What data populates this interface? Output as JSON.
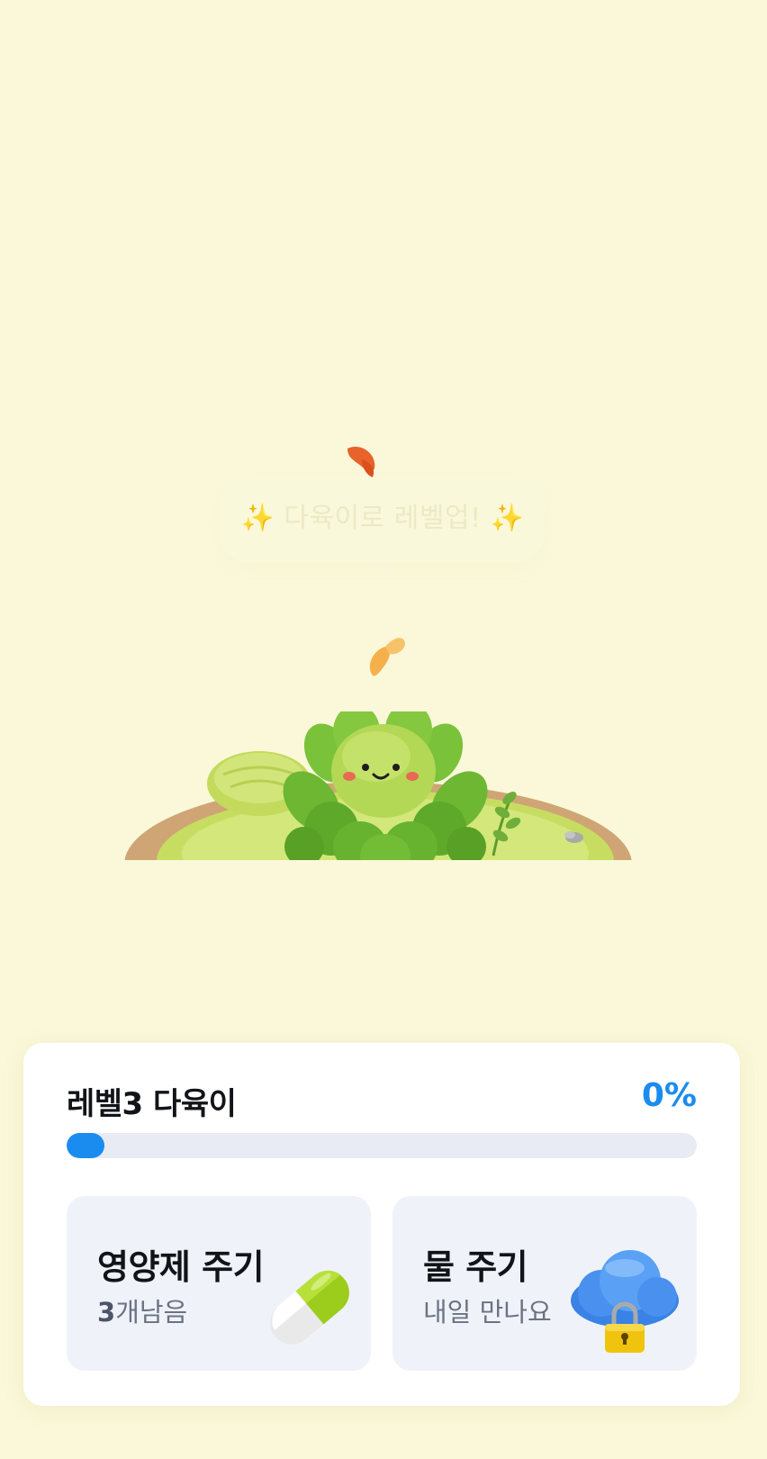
{
  "scene": {
    "bubble_text": "✨ 다육이로 레벨업! ✨"
  },
  "level": {
    "title": "레벨3 다육이",
    "percent_label": "0%",
    "progress": 0.06
  },
  "actions": {
    "nutrient": {
      "title": "영양제 주기",
      "count": "3",
      "remaining_suffix": "개남음",
      "icon": "pill-icon"
    },
    "water": {
      "title": "물 주기",
      "subtitle": "내일 만나요",
      "icon": "locked-cloud-icon"
    }
  },
  "colors": {
    "background": "#faf8d9",
    "accent": "#1a8cf0",
    "card": "#ffffff",
    "action_bg": "#eff3f9"
  }
}
